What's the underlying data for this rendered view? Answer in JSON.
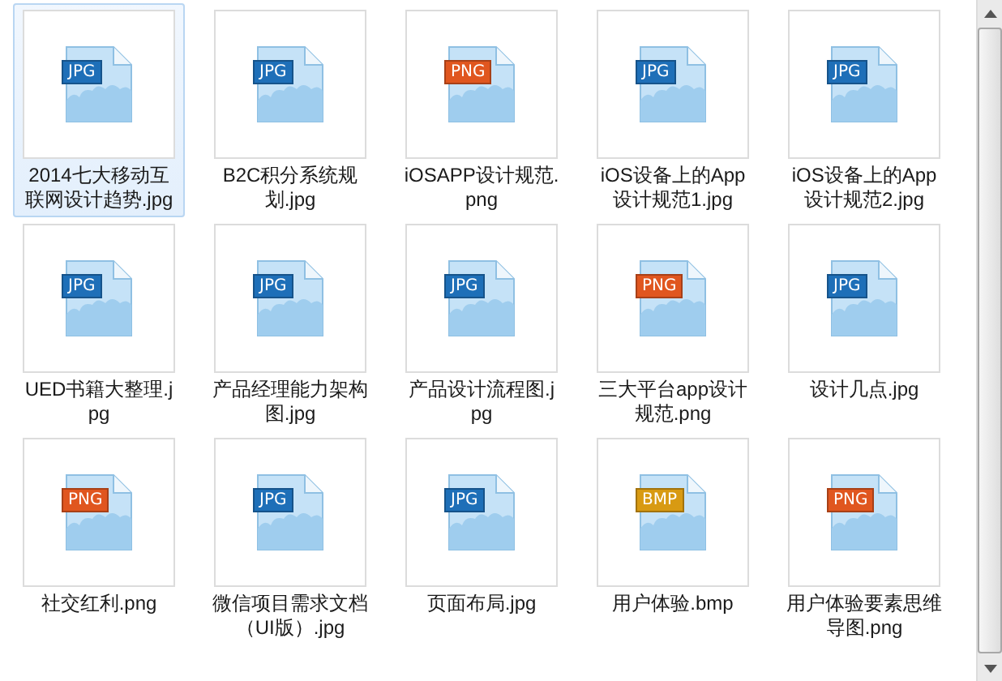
{
  "files": [
    {
      "name": "2014七大移动互联网设计趋势.jpg",
      "badge": "JPG",
      "color": "#1e6fb8",
      "selected": true
    },
    {
      "name": "B2C积分系统规划.jpg",
      "badge": "JPG",
      "color": "#1e6fb8",
      "selected": false
    },
    {
      "name": "iOSAPP设计规范.png",
      "badge": "PNG",
      "color": "#e0561f",
      "selected": false
    },
    {
      "name": "iOS设备上的App设计规范1.jpg",
      "badge": "JPG",
      "color": "#1e6fb8",
      "selected": false
    },
    {
      "name": "iOS设备上的App设计规范2.jpg",
      "badge": "JPG",
      "color": "#1e6fb8",
      "selected": false
    },
    {
      "name": "UED书籍大整理.jpg",
      "badge": "JPG",
      "color": "#1e6fb8",
      "selected": false
    },
    {
      "name": "产品经理能力架构图.jpg",
      "badge": "JPG",
      "color": "#1e6fb8",
      "selected": false
    },
    {
      "name": "产品设计流程图.jpg",
      "badge": "JPG",
      "color": "#1e6fb8",
      "selected": false
    },
    {
      "name": "三大平台app设计规范.png",
      "badge": "PNG",
      "color": "#e0561f",
      "selected": false
    },
    {
      "name": "设计几点.jpg",
      "badge": "JPG",
      "color": "#1e6fb8",
      "selected": false
    },
    {
      "name": "社交红利.png",
      "badge": "PNG",
      "color": "#e0561f",
      "selected": false
    },
    {
      "name": "微信项目需求文档（UI版）.jpg",
      "badge": "JPG",
      "color": "#1e6fb8",
      "selected": false
    },
    {
      "name": "页面布局.jpg",
      "badge": "JPG",
      "color": "#1e6fb8",
      "selected": false
    },
    {
      "name": "用户体验.bmp",
      "badge": "BMP",
      "color": "#d89a12",
      "selected": false
    },
    {
      "name": "用户体验要素思维导图.png",
      "badge": "PNG",
      "color": "#e0561f",
      "selected": false
    }
  ]
}
